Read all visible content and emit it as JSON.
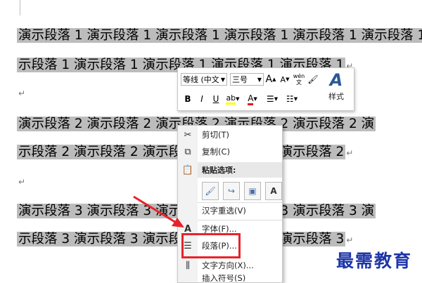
{
  "document": {
    "lines": [
      {
        "text": "演示段落 1 演示段落 1 演示段落 1 演示段落 1 演示段落 1 演示段落 1 演"
      },
      {
        "text": "示段落 1 演示段落 1 演示段落 1 演示段落 1 演示段落 1"
      },
      {
        "text": "演示段落 2 演示段落 2 演示段落 2 演示段落 2 演示段落 2 演"
      },
      {
        "text": "示段落 2 演示段落 2 演示段落 2 演示段落 2 演示段落 2"
      },
      {
        "text": "演示段落 3 演示段落 3 演示段落 3 演示段落 3 演示段落 3 演"
      },
      {
        "text": "示段落 3 演示段落 3 演示段落 3 演示段落 3 演示段落 3"
      }
    ],
    "paragraph_mark": "↵"
  },
  "mini_toolbar": {
    "font_name": "等线 (中文",
    "font_size": "三号",
    "grow_font": "A",
    "shrink_font": "A",
    "phonetic": "wén 文",
    "bold": "B",
    "italic": "I",
    "underline": "U",
    "font_color": "A",
    "styles_label": "样式"
  },
  "context_menu": {
    "cut": "剪切(T)",
    "copy": "复制(C)",
    "paste_header": "粘贴选项:",
    "reconvert": "汉字重选(V)",
    "font": "字体(F)...",
    "paragraph": "段落(P)...",
    "text_direction": "文字方向(X)...",
    "insert_symbol": "插入符号(S)"
  },
  "watermark": "最需教育",
  "colors": {
    "highlight": "#bcbcbc",
    "annotation": "#e8222a",
    "watermark": "#1e36a8"
  }
}
